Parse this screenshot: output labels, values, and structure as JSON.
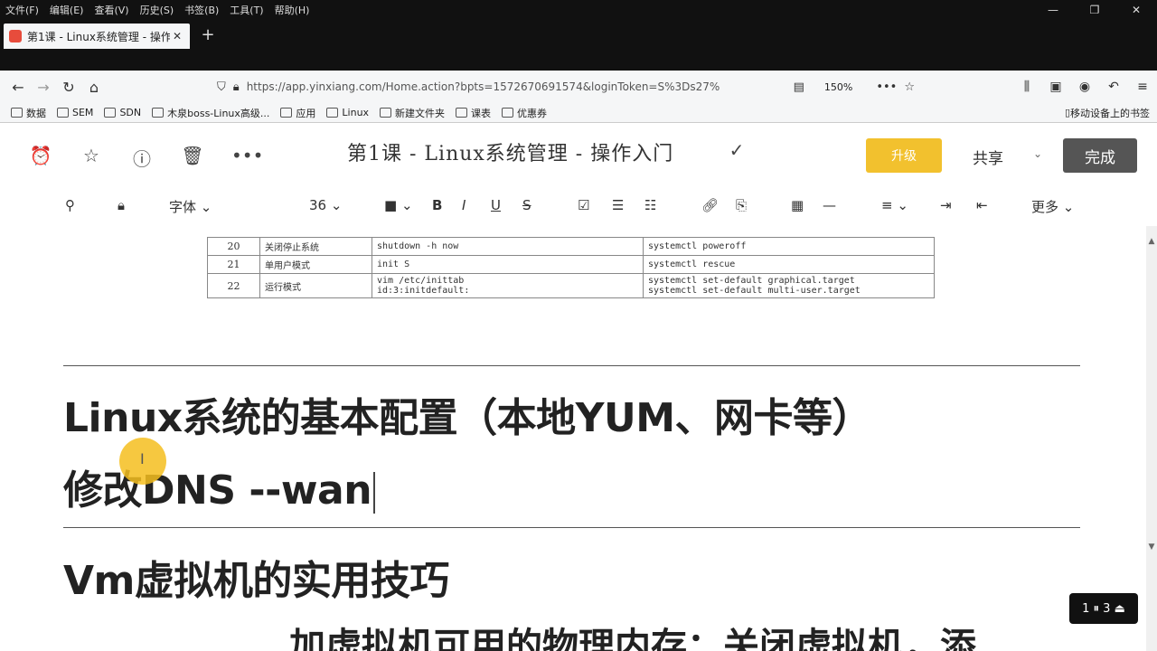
{
  "menubar": {
    "items": [
      "文件(F)",
      "编辑(E)",
      "查看(V)",
      "历史(S)",
      "书签(B)",
      "工具(T)",
      "帮助(H)"
    ],
    "window_controls": [
      "—",
      "❐",
      "✕"
    ]
  },
  "tab": {
    "title": "第1课 - Linux系统管理 - 操作",
    "close": "✕"
  },
  "newtab": "+",
  "address": {
    "url": "https://app.yinxiang.com/Home.action?bpts=1572670691574&loginToken=S%3Ds27%",
    "zoom": "150%"
  },
  "bookmarks": {
    "items": [
      "数据",
      "SEM",
      "SDN",
      "木泉boss-Linux高级...",
      "应用",
      "Linux",
      "新建文件夹",
      "课表",
      "优惠券"
    ],
    "mobile": "移动设备上的书签"
  },
  "editor": {
    "title": "第1课 - Linux系统管理 - 操作入门",
    "upgrade_label": "升级",
    "share_label": "共享",
    "done_label": "完成",
    "font_label": "字体",
    "font_size": "36",
    "more_label": "更多"
  },
  "table": {
    "rows": [
      {
        "no": "20",
        "desc": "关闭停止系统",
        "old": "shutdown -h now",
        "new": "systemctl poweroff"
      },
      {
        "no": "21",
        "desc": "单用户模式",
        "old": "init S",
        "new": "systemctl rescue"
      },
      {
        "no": "22",
        "desc": "运行模式",
        "old": "vim /etc/inittab",
        "old2": "id:3:initdefault:",
        "new": "systemctl set-default graphical.target",
        "new2": "systemctl set-default multi-user.target"
      }
    ]
  },
  "content": {
    "heading1": "Linux系统的基本配置（本地YUM、网卡等）",
    "heading2": "修改DNS --wan",
    "heading3": "Vm虚拟机的实用技巧",
    "partial_line": "加虚拟机可用的物理内存：关闭虚拟机，添"
  },
  "overlay": {
    "label": "1 ⏸ 3 ⏏"
  }
}
